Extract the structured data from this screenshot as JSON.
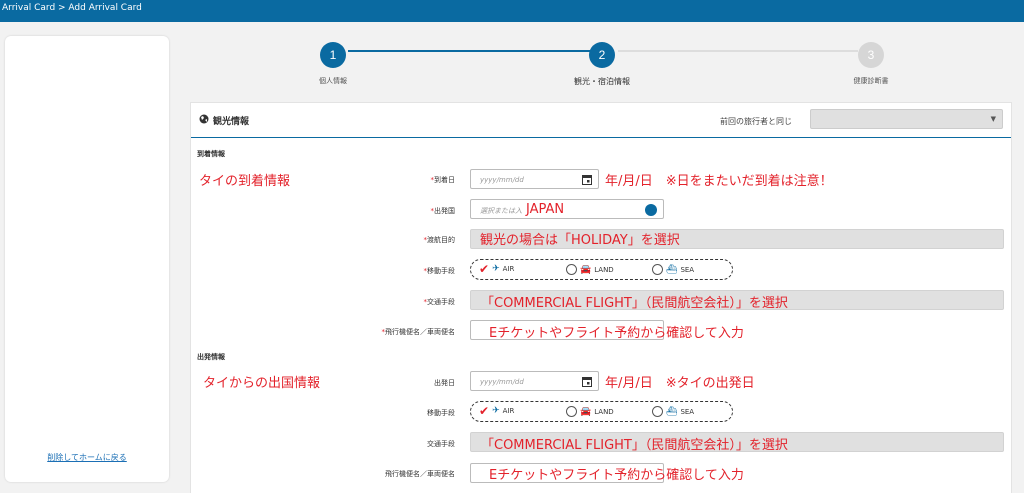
{
  "breadcrumb": "Arrival Card > Add Arrival Card",
  "sidebar": {
    "back_link": "削除してホームに戻る"
  },
  "steps": [
    {
      "number": "1",
      "label": "個人情報"
    },
    {
      "number": "2",
      "label": "観光・宿泊情報"
    },
    {
      "number": "3",
      "label": "健康診断書"
    }
  ],
  "colors": {
    "primary": "#0a6aa1",
    "step_active": "#0a6aa1",
    "step_inactive": "#d6d6d6",
    "annotation": "#e3222b",
    "required": "#e3222b"
  },
  "card": {
    "title": "観光情報",
    "prev_traveler_label": "前回の旅行者と同じ",
    "prev_traveler_value": ""
  },
  "arrival": {
    "section_title": "到着情報",
    "note": "タイの到着情報",
    "date_label": "到着日",
    "date_placeholder": "yyyy/mm/dd",
    "date_note": "年/月/日　※日をまたいだ到着は注意！",
    "country_label": "出発国",
    "country_placeholder": "選択または入",
    "country_note": "JAPAN",
    "purpose_label": "渡航目的",
    "purpose_note": "観光の場合は「HOLIDAY」を選択",
    "mode_label": "移動手段",
    "mode_options": [
      "AIR",
      "LAND",
      "SEA"
    ],
    "mode_selected": "AIR",
    "transport_label": "交通手段",
    "transport_note": "「COMMERCIAL FLIGHT」（民間航空会社）」を選択",
    "flight_label": "飛行機便名／車両便名",
    "flight_note": "Eチケットやフライト予約から確認して入力"
  },
  "departure": {
    "section_title": "出発情報",
    "note": "タイからの出国情報",
    "date_label": "出発日",
    "date_placeholder": "yyyy/mm/dd",
    "date_note": "年/月/日　※タイの出発日",
    "mode_label": "移動手段",
    "mode_options": [
      "AIR",
      "LAND",
      "SEA"
    ],
    "mode_selected": "AIR",
    "transport_label": "交通手段",
    "transport_note": "「COMMERCIAL FLIGHT」（民間航空会社）」を選択",
    "flight_label": "飛行機便名／車両便名",
    "flight_note": "Eチケットやフライト予約から確認して入力"
  }
}
